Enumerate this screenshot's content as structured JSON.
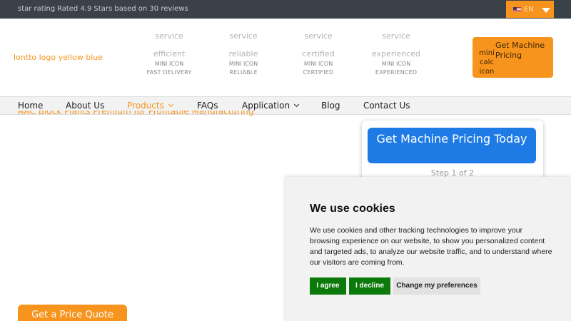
{
  "topbar": {
    "rating_image_alt": "star rating",
    "reviews_text": "Rated 4.9 Stars based on 30 reviews",
    "language": {
      "code": "EN",
      "flag_icon": "us-flag-icon",
      "dropdown_icon": "caret-down-icon"
    }
  },
  "header": {
    "logo_alt": "lontto logo yellow blue",
    "features": [
      {
        "line1": "service",
        "line2": "efficient",
        "icon_alt": "MINI ICON",
        "caption": "FAST DELIVERY"
      },
      {
        "line1": "service",
        "line2": "reliable",
        "icon_alt": "MINI ICON",
        "caption": "RELIABLE"
      },
      {
        "line1": "service",
        "line2": "certified",
        "icon_alt": "MINI ICON",
        "caption": "CERTIFIED"
      },
      {
        "line1": "service",
        "line2": "experienced",
        "icon_alt": "MINI ICON",
        "caption": "EXPERIENCED"
      }
    ],
    "cta": {
      "icon_alt": "mini calc icon",
      "label": "Get Machine Pricing"
    }
  },
  "nav": {
    "items": [
      {
        "label": "Home"
      },
      {
        "label": "About Us"
      },
      {
        "label": "Products",
        "has_dropdown": true,
        "active": true
      },
      {
        "label": "FAQs"
      },
      {
        "label": "Application",
        "has_dropdown": true
      },
      {
        "label": "Blog"
      },
      {
        "label": "Contact Us"
      }
    ]
  },
  "hero": {
    "subtitle": "AAC Block Plants Premium for Profitable Manufacturing",
    "quote_button": "Get a Price Quote"
  },
  "form": {
    "button_label": "Get Machine Pricing Today",
    "step_text": "Step 1 of 2"
  },
  "cookie": {
    "title": "We use cookies",
    "body": "We use cookies and other tracking technologies to improve your browsing experience on our website, to show you personalized content and targeted ads, to analyze our website traffic, and to understand where our visitors are coming from.",
    "agree_label": "I agree",
    "decline_label": "I decline",
    "prefs_label": "Change my preferences"
  },
  "colors": {
    "accent": "#f7941d",
    "topbar": "#3b4148",
    "primary_blue": "#1e7be6",
    "cookie_green": "#0b7a0b"
  }
}
